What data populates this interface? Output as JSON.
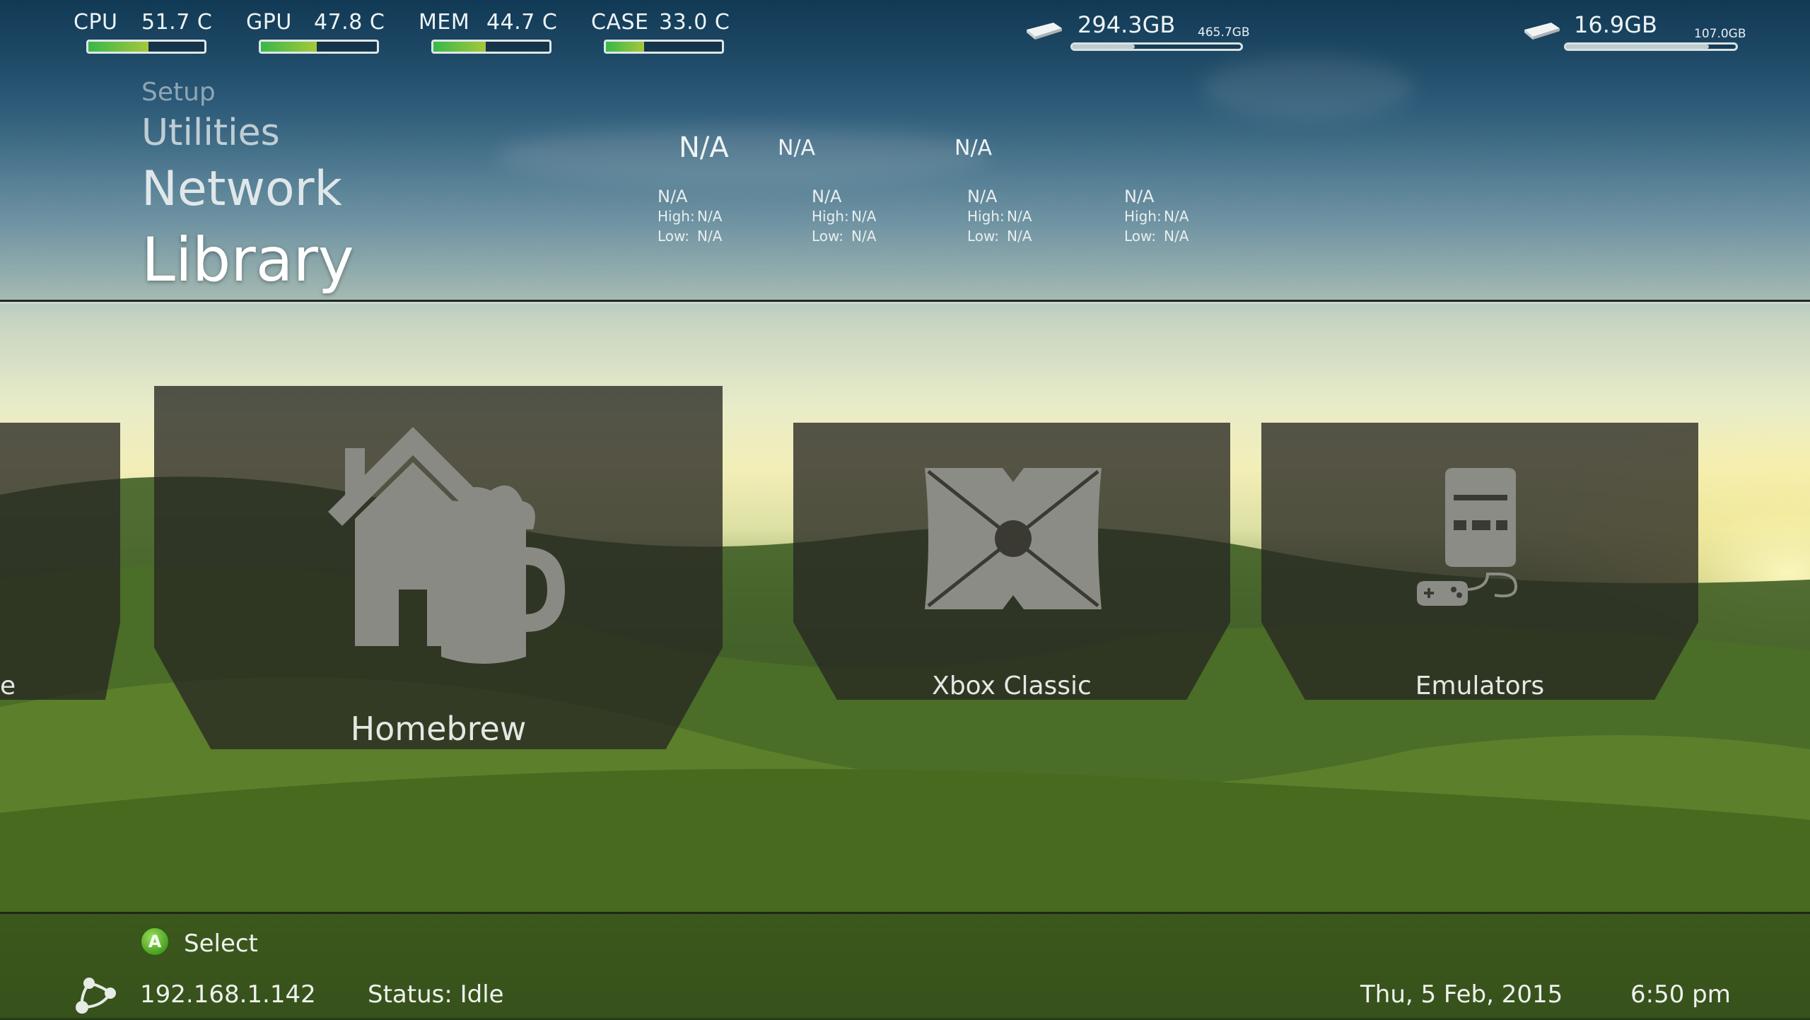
{
  "stats": {
    "cpu": {
      "label": "CPU",
      "value": "51.7 C",
      "level": 0.52
    },
    "gpu": {
      "label": "GPU",
      "value": "47.8 C",
      "level": 0.48
    },
    "mem": {
      "label": "MEM",
      "value": "44.7 C",
      "level": 0.45
    },
    "case": {
      "label": "CASE",
      "value": "33.0 C",
      "level": 0.33
    }
  },
  "drives": [
    {
      "free": "294.3GB",
      "total": "465.7GB",
      "used_fraction": 0.37
    },
    {
      "free": "16.9GB",
      "total": "107.0GB",
      "used_fraction": 0.84
    }
  ],
  "menu": {
    "items": [
      "Setup",
      "Utilities",
      "Network",
      "Library"
    ],
    "selected": "Library"
  },
  "weather": {
    "current": [
      "N/A",
      "N/A",
      "N/A"
    ],
    "days": [
      {
        "day": "N/A",
        "high_label": "High:",
        "high": "N/A",
        "low_label": "Low:",
        "low": "N/A"
      },
      {
        "day": "N/A",
        "high_label": "High:",
        "high": "N/A",
        "low_label": "Low:",
        "low": "N/A"
      },
      {
        "day": "N/A",
        "high_label": "High:",
        "high": "N/A",
        "low_label": "Low:",
        "low": "N/A"
      },
      {
        "day": "N/A",
        "high_label": "High:",
        "high": "N/A",
        "low_label": "Low:",
        "low": "N/A"
      }
    ]
  },
  "tiles": {
    "partial_label": "e",
    "items": [
      {
        "label": "Homebrew",
        "icon": "homebrew-icon"
      },
      {
        "label": "Xbox Classic",
        "icon": "xbox-icon"
      },
      {
        "label": "Emulators",
        "icon": "console-icon"
      }
    ]
  },
  "footer": {
    "button": "A",
    "action": "Select",
    "ip": "192.168.1.142",
    "status": "Status: Idle",
    "date": "Thu, 5 Feb, 2015",
    "time": "6:50 pm"
  },
  "colors": {
    "bar_fill": "#38b84a",
    "a_button": "#5fb82e"
  }
}
